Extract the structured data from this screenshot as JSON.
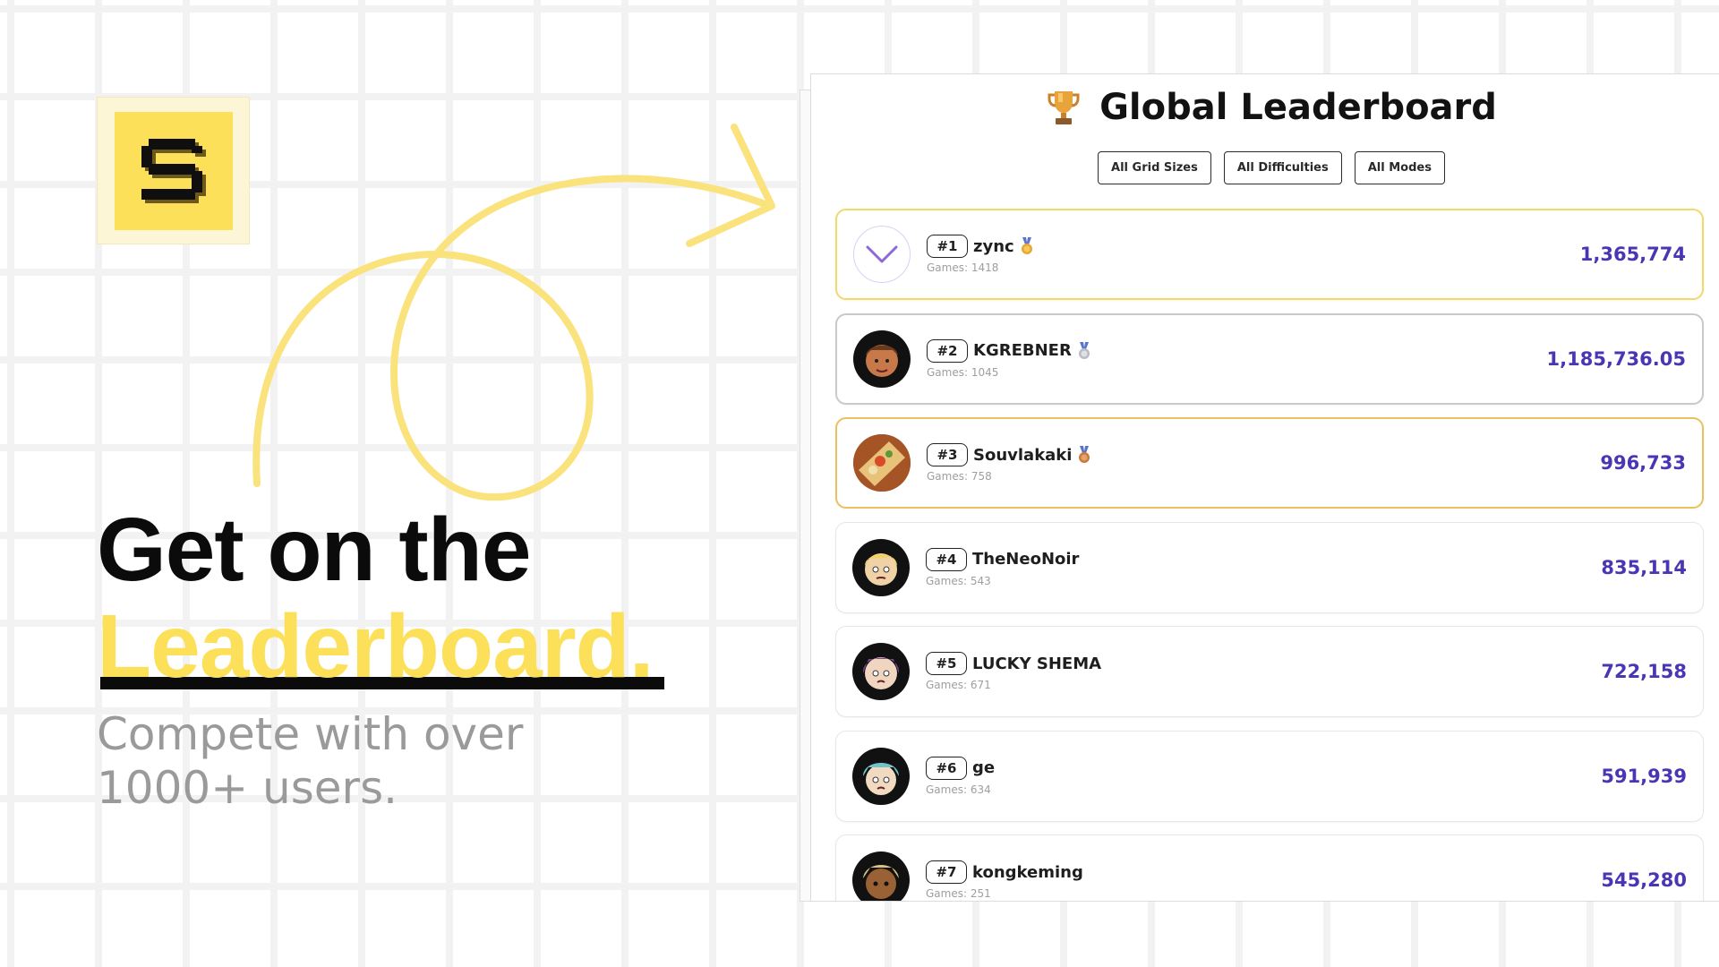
{
  "hero": {
    "title": "Get on the",
    "accent": "Leaderboard.",
    "subtitle": "Compete with over 1000+ users."
  },
  "logo": {
    "letter": "S",
    "icon": "logo-s-icon"
  },
  "leaderboard": {
    "title": "Global Leaderboard",
    "trophy_icon": "trophy-icon",
    "filters": [
      "All Grid Sizes",
      "All Difficulties",
      "All Modes"
    ],
    "rows": [
      {
        "rank": "#1",
        "name": "zync",
        "games": "Games: 1418",
        "score": "1,365,774",
        "medal": "gold"
      },
      {
        "rank": "#2",
        "name": "KGREBNER",
        "games": "Games: 1045",
        "score": "1,185,736.05",
        "medal": "silver"
      },
      {
        "rank": "#3",
        "name": "Souvlakaki",
        "games": "Games: 758",
        "score": "996,733",
        "medal": "bronze"
      },
      {
        "rank": "#4",
        "name": "TheNeoNoir",
        "games": "Games: 543",
        "score": "835,114",
        "medal": ""
      },
      {
        "rank": "#5",
        "name": "LUCKY SHEMA",
        "games": "Games: 671",
        "score": "722,158",
        "medal": ""
      },
      {
        "rank": "#6",
        "name": "ge",
        "games": "Games: 634",
        "score": "591,939",
        "medal": ""
      },
      {
        "rank": "#7",
        "name": "kongkeming",
        "games": "Games: 251",
        "score": "545,280",
        "medal": ""
      }
    ]
  },
  "colors": {
    "accent_yellow": "#fde05a",
    "score_purple": "#4a36b4",
    "gold_border": "#f3d86a"
  }
}
